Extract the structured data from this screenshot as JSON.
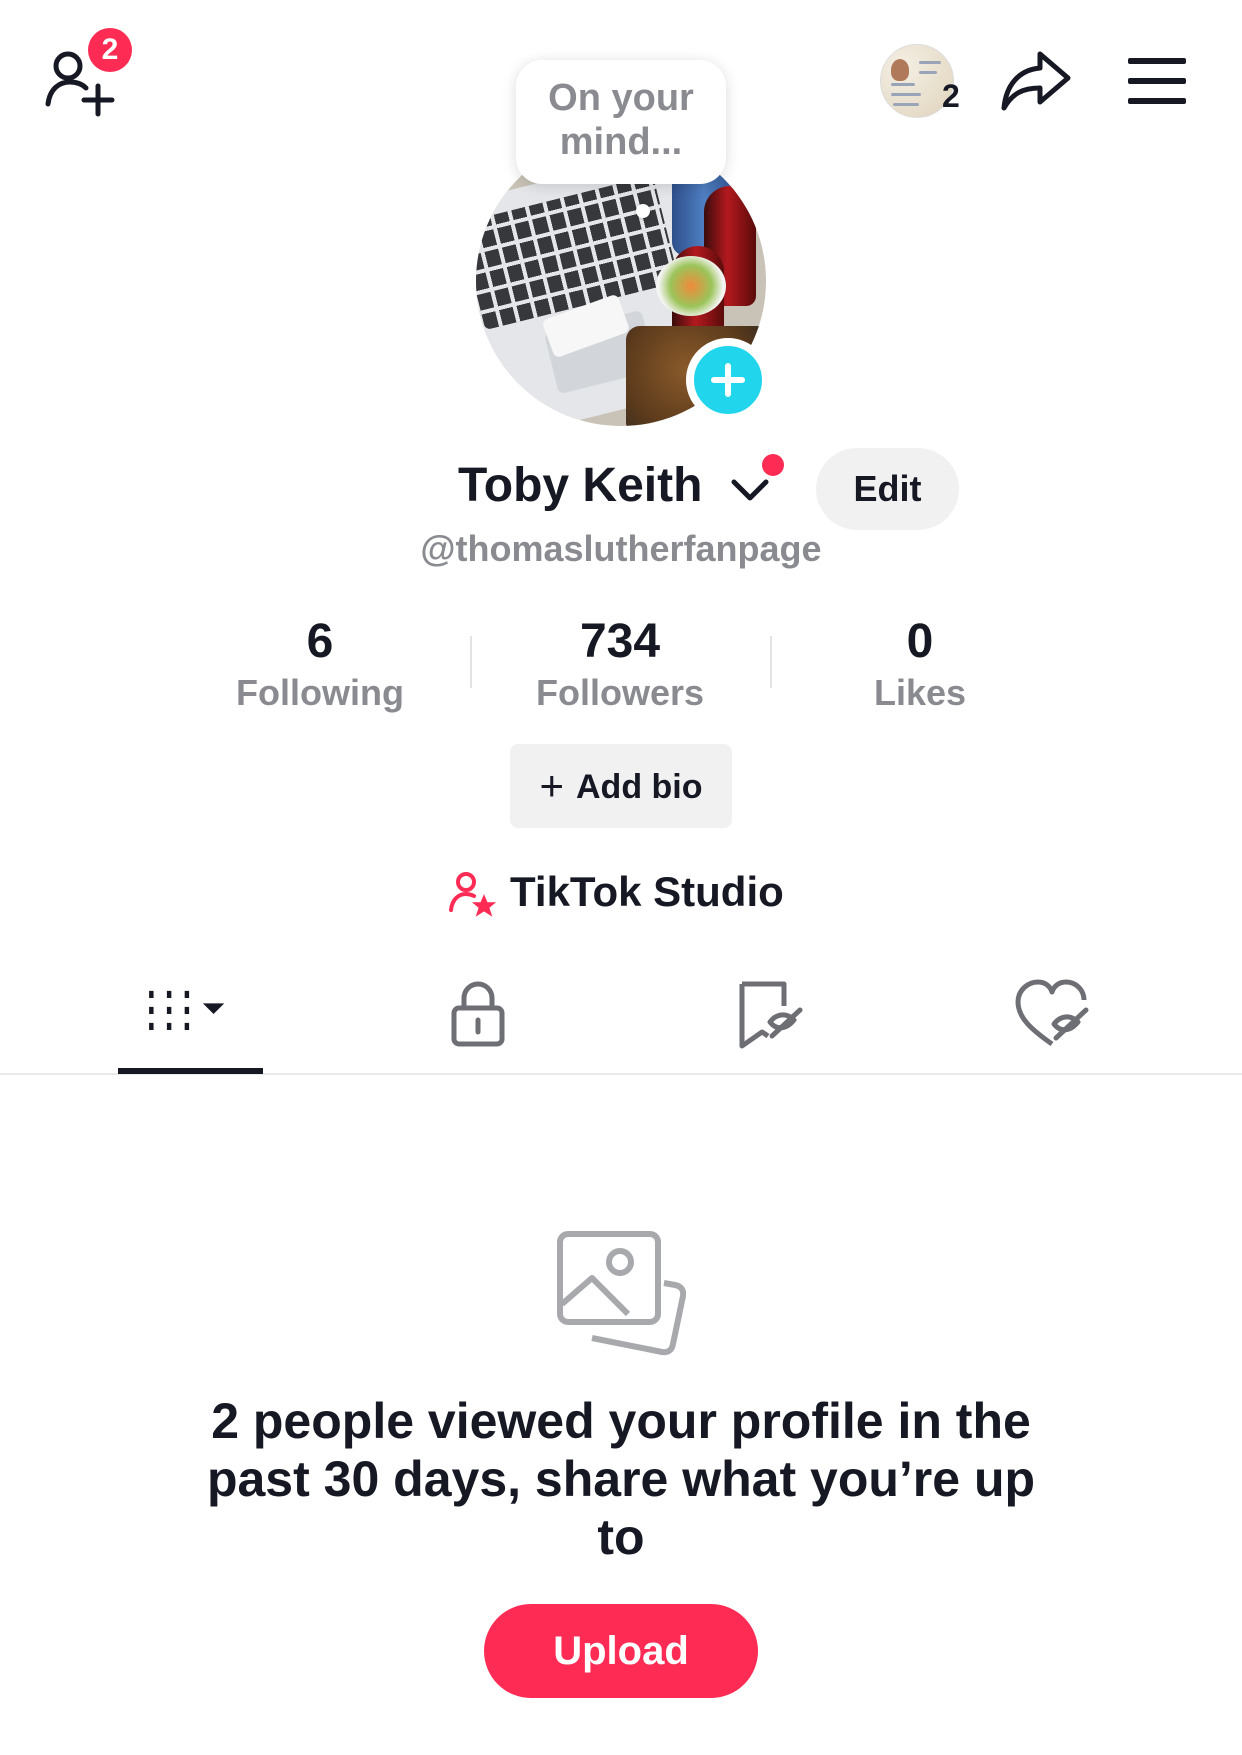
{
  "header": {
    "notification_count": "2",
    "story_count": "2"
  },
  "thought_bubble": {
    "text": "On your mind..."
  },
  "profile": {
    "name": "Toby Keith",
    "handle": "@thomaslutherfanpage",
    "edit_label": "Edit"
  },
  "stats": [
    {
      "value": "6",
      "label": "Following"
    },
    {
      "value": "734",
      "label": "Followers"
    },
    {
      "value": "0",
      "label": "Likes"
    }
  ],
  "add_bio": {
    "plus": "+",
    "label": "Add bio"
  },
  "studio": {
    "label": "TikTok Studio"
  },
  "tabs": [
    {
      "icon": "videos-grid-icon",
      "selected": true
    },
    {
      "icon": "lock-icon",
      "selected": false
    },
    {
      "icon": "hidden-bookmark-icon",
      "selected": false
    },
    {
      "icon": "hidden-heart-icon",
      "selected": false
    }
  ],
  "empty_state": {
    "icon": "photo-stack-icon",
    "message": "2 people viewed your profile in the past 30 days, share what you’re up to",
    "upload_label": "Upload"
  },
  "colors": {
    "accent": "#fe2c55",
    "avatar_plus": "#20d5ec",
    "text_primary": "#161823",
    "text_secondary": "#8a8b91",
    "button_bg": "#f1f1f2"
  }
}
